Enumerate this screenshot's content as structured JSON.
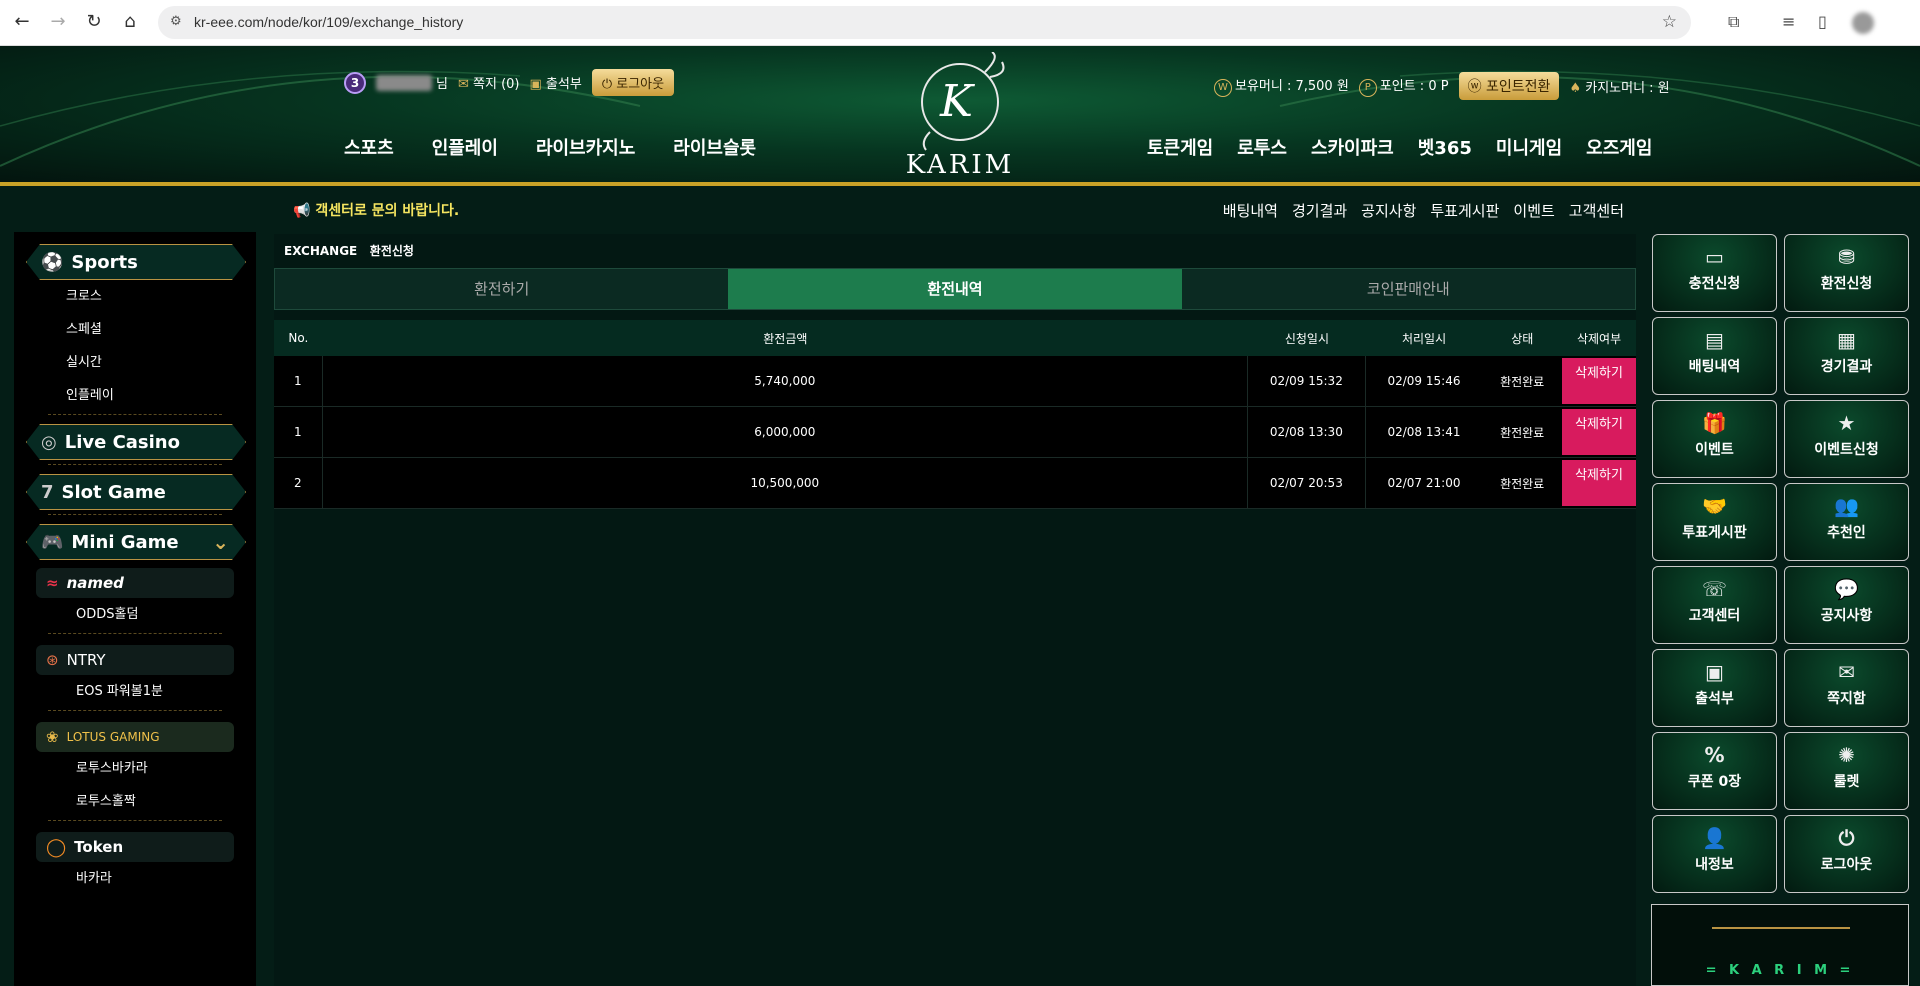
{
  "browser": {
    "url": "kr-eee.com/node/kor/109/exchange_history"
  },
  "header": {
    "level": "3",
    "user_suffix": "님",
    "memo_link": "쪽지 (0)",
    "attendance_link": "출석부",
    "logout_label": "로그아웃",
    "money_label": "보유머니 : 7,500 원",
    "point_label": "포인트 : 0 P",
    "point_convert_label": "포인트전환",
    "casino_money_label": "카지노머니 : 원",
    "logo_text": "KARIM",
    "logo_letter": "K",
    "nav_left": [
      "스포츠",
      "인플레이",
      "라이브카지노",
      "라이브슬롯"
    ],
    "nav_right": [
      "토큰게임",
      "로투스",
      "스카이파크",
      "벳365",
      "미니게임",
      "오즈게임"
    ]
  },
  "subnav": {
    "notice": "객센터로 문의 바랍니다.",
    "links": [
      "배팅내역",
      "경기결과",
      "공지사항",
      "투표게시판",
      "이벤트",
      "고객센터"
    ]
  },
  "sidebar": {
    "sports": {
      "label": "Sports",
      "items": [
        "크로스",
        "스페셜",
        "실시간",
        "인플레이"
      ]
    },
    "live_casino": {
      "label": "Live Casino"
    },
    "slot_game": {
      "label": "Slot Game"
    },
    "mini_game": {
      "label": "Mini Game"
    },
    "named": {
      "label": "named",
      "items": [
        "ODDS홀덤"
      ]
    },
    "ntry": {
      "label": "NTRY",
      "items": [
        "EOS 파워볼1분"
      ]
    },
    "lotus": {
      "label": "LOTUS GAMING",
      "items": [
        "로투스바카라",
        "로투스홀짝"
      ]
    },
    "token": {
      "label": "Token",
      "items": [
        "바카라"
      ]
    }
  },
  "main": {
    "breadcrumb_section": "EXCHANGE",
    "breadcrumb_page": "환전신청",
    "tabs": [
      {
        "label": "환전하기",
        "active": false
      },
      {
        "label": "환전내역",
        "active": true
      },
      {
        "label": "코인판매안내",
        "active": false
      }
    ],
    "table": {
      "headers": [
        "No.",
        "환전금액",
        "신청일시",
        "처리일시",
        "상태",
        "삭제여부"
      ],
      "rows": [
        {
          "no": "1",
          "amount": "5,740,000",
          "requested": "02/09 15:32",
          "processed": "02/09 15:46",
          "status": "환전완료",
          "delete_label": "삭제하기"
        },
        {
          "no": "1",
          "amount": "6,000,000",
          "requested": "02/08 13:30",
          "processed": "02/08 13:41",
          "status": "환전완료",
          "delete_label": "삭제하기"
        },
        {
          "no": "2",
          "amount": "10,500,000",
          "requested": "02/07 20:53",
          "processed": "02/07 21:00",
          "status": "환전완료",
          "delete_label": "삭제하기"
        }
      ]
    }
  },
  "quick_menu": [
    {
      "label": "충전신청",
      "icon": "wallet-icon"
    },
    {
      "label": "환전신청",
      "icon": "coins-icon"
    },
    {
      "label": "배팅내역",
      "icon": "slip-icon"
    },
    {
      "label": "경기결과",
      "icon": "scoreboard-icon"
    },
    {
      "label": "이벤트",
      "icon": "gift-icon"
    },
    {
      "label": "이벤트신청",
      "icon": "star-icon"
    },
    {
      "label": "투표게시판",
      "icon": "handshake-icon"
    },
    {
      "label": "추천인",
      "icon": "users-icon"
    },
    {
      "label": "고객센터",
      "icon": "phone-icon"
    },
    {
      "label": "공지사항",
      "icon": "chat-icon"
    },
    {
      "label": "출석부",
      "icon": "calendar-icon"
    },
    {
      "label": "쪽지함",
      "icon": "mail-icon"
    },
    {
      "label": "쿠폰 0장",
      "icon": "coupon-icon"
    },
    {
      "label": "룰렛",
      "icon": "roulette-icon"
    },
    {
      "label": "내정보",
      "icon": "user-icon"
    },
    {
      "label": "로그아웃",
      "icon": "power-icon"
    }
  ],
  "banner": {
    "text": "= K A R I M ="
  },
  "colors": {
    "accent_gold": "#c9a227",
    "active_tab": "#1d7c4d",
    "delete_button": "#d81b5e",
    "notice": "#f5e560"
  }
}
